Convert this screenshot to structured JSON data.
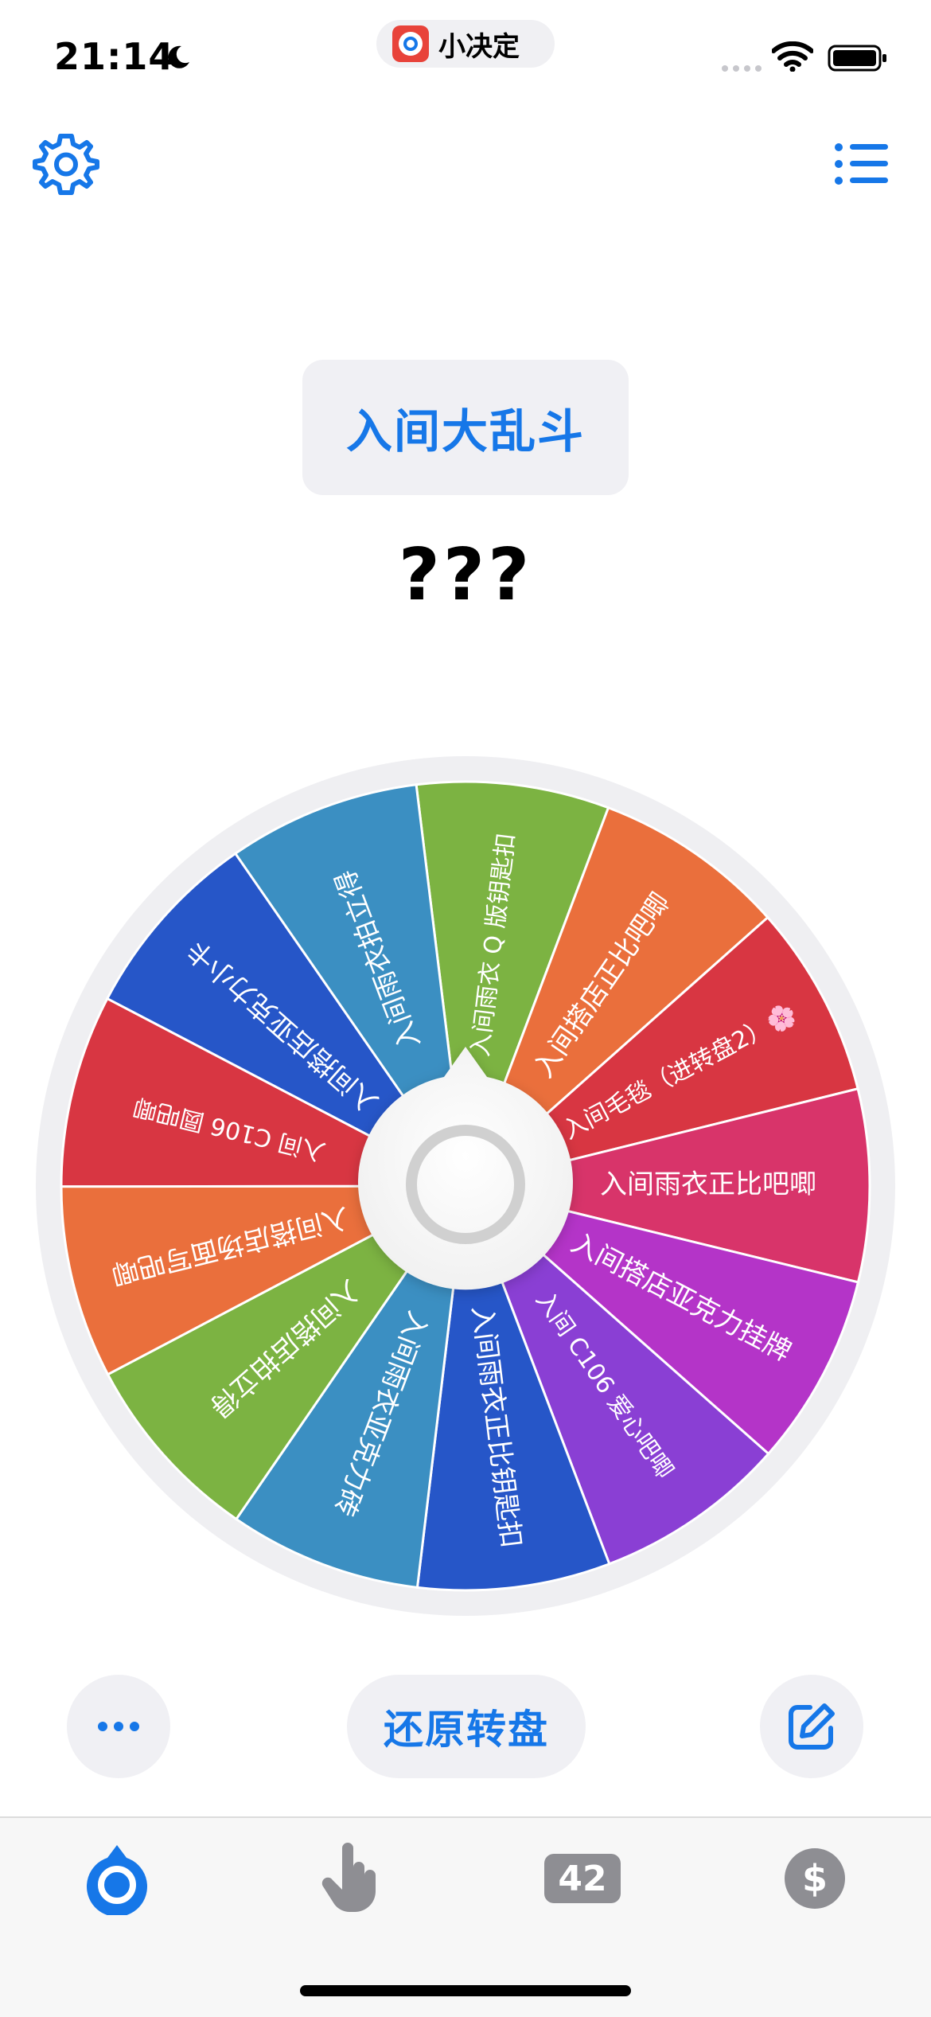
{
  "status": {
    "time": "21:14"
  },
  "app_pill": {
    "name": "小决定"
  },
  "title": "入间大乱斗",
  "result": "???",
  "wheel": {
    "pointer_color": "#ffffff",
    "segments": [
      {
        "label": "入间雨衣 Q 版钥匙扣",
        "color": "#7cb342"
      },
      {
        "label": "入间搭店正比吧唧",
        "color": "#ea6f3c"
      },
      {
        "label": "入间毛毯（进转盘2）🌸",
        "color": "#d83642"
      },
      {
        "label": "入间雨衣正比吧唧",
        "color": "#d8346a"
      },
      {
        "label": "入间搭店亚克力挂牌",
        "color": "#b434c8"
      },
      {
        "label": "入间 C106 爱心吧唧",
        "color": "#8a3fd4"
      },
      {
        "label": "入间雨衣正比钥匙扣",
        "color": "#2656c8"
      },
      {
        "label": "入间雨衣亚克力砖",
        "color": "#3b8fc2"
      },
      {
        "label": "入间搭店拍立得",
        "color": "#7cb342"
      },
      {
        "label": "入间搭店场面写吧唧",
        "color": "#ea6f3c"
      },
      {
        "label": "入间 C106 圆吧唧",
        "color": "#d83642"
      },
      {
        "label": "入间搭店亚克力小卡",
        "color": "#2656c8"
      },
      {
        "label": "入间雨衣拍立得",
        "color": "#3b8fc2"
      }
    ]
  },
  "buttons": {
    "reset_label": "还原转盘"
  },
  "tabs": {
    "count_badge": "42"
  },
  "colors": {
    "accent": "#1677e8",
    "inactive": "#8e8e93"
  }
}
